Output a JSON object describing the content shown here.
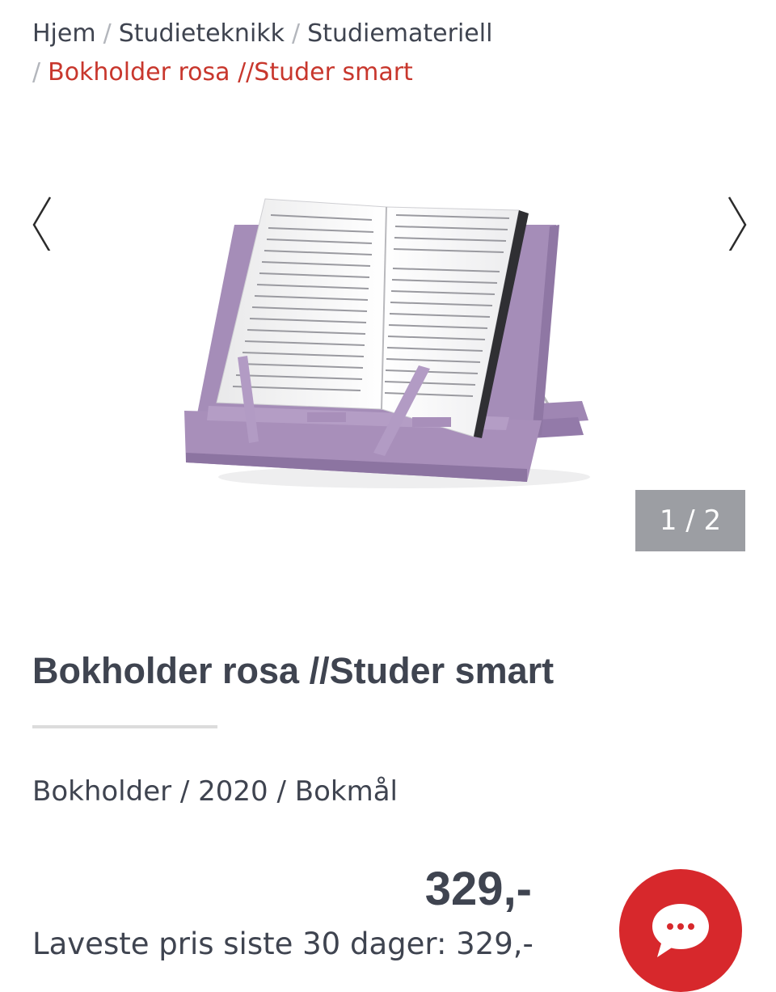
{
  "breadcrumb": {
    "items": [
      "Hjem",
      "Studieteknikk",
      "Studiemateriell"
    ],
    "separator": "/",
    "current": "Bokholder rosa //Studer smart"
  },
  "gallery": {
    "counter": "1 / 2",
    "prev_icon": "chevron-left-icon",
    "next_icon": "chevron-right-icon"
  },
  "product": {
    "title": "Bokholder rosa //Studer smart",
    "meta": "Bokholder / 2020 / Bokmål",
    "price": "329,-",
    "lowest_price": "Laveste pris siste 30 dager: 329,-"
  },
  "chat": {
    "icon": "chat-bubble-icon"
  },
  "colors": {
    "accent": "#c8372d",
    "chat_button": "#d7282c",
    "text": "#3f4450",
    "counter_bg": "#9c9ea3",
    "product_purple": "#a88fba"
  }
}
